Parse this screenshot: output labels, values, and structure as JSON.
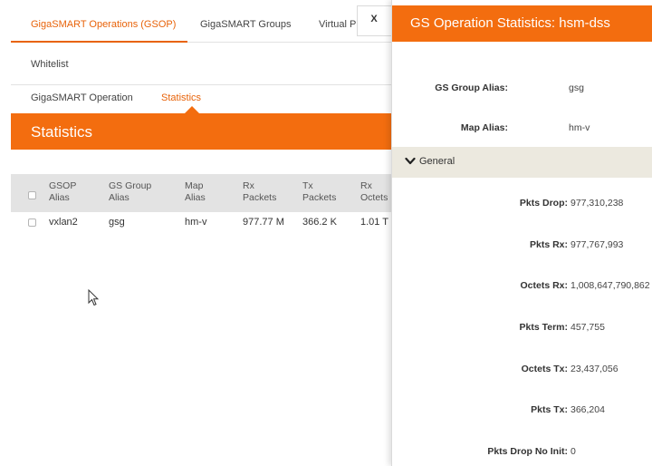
{
  "top_tabs": [
    {
      "label": "GigaSMART Operations (GSOP)",
      "active": true
    },
    {
      "label": "GigaSMART Groups",
      "active": false
    },
    {
      "label": "Virtual P",
      "active": false
    }
  ],
  "whitelist_label": "Whitelist",
  "sub_tabs": [
    {
      "label": "GigaSMART Operation",
      "active": false
    },
    {
      "label": "Statistics",
      "active": true
    }
  ],
  "statistics_title": "Statistics",
  "table": {
    "headers": [
      [
        "GSOP",
        "Alias"
      ],
      [
        "GS Group",
        "Alias"
      ],
      [
        "Map",
        "Alias"
      ],
      [
        "Rx",
        "Packets"
      ],
      [
        "Tx",
        "Packets"
      ],
      [
        "Rx",
        "Octets"
      ]
    ],
    "rows": [
      [
        "vxlan2",
        "gsg",
        "hm-v",
        "977.77 M",
        "366.2 K",
        "1.01 T"
      ]
    ]
  },
  "panel": {
    "title": "GS Operation Statistics: hsm-dss",
    "close_label": "X",
    "fields": [
      {
        "label": "GS Group Alias:",
        "value": "gsg"
      },
      {
        "label": "Map Alias:",
        "value": "hm-v"
      }
    ],
    "section_label": "General",
    "details": [
      {
        "label": "Pkts Drop:",
        "value": "977,310,238"
      },
      {
        "label": "Pkts Rx:",
        "value": "977,767,993"
      },
      {
        "label": "Octets Rx:",
        "value": "1,008,647,790,862"
      },
      {
        "label": "Pkts Term:",
        "value": "457,755"
      },
      {
        "label": "Octets Tx:",
        "value": "23,437,056"
      },
      {
        "label": "Pkts Tx:",
        "value": "366,204"
      },
      {
        "label": "Pkts Drop No Init:",
        "value": "0"
      }
    ]
  },
  "colors": {
    "accent": "#f36d0f",
    "active_tab_text": "#e8630a",
    "table_header_bg": "#e3e3e3",
    "section_bar_bg": "#ece9df"
  }
}
